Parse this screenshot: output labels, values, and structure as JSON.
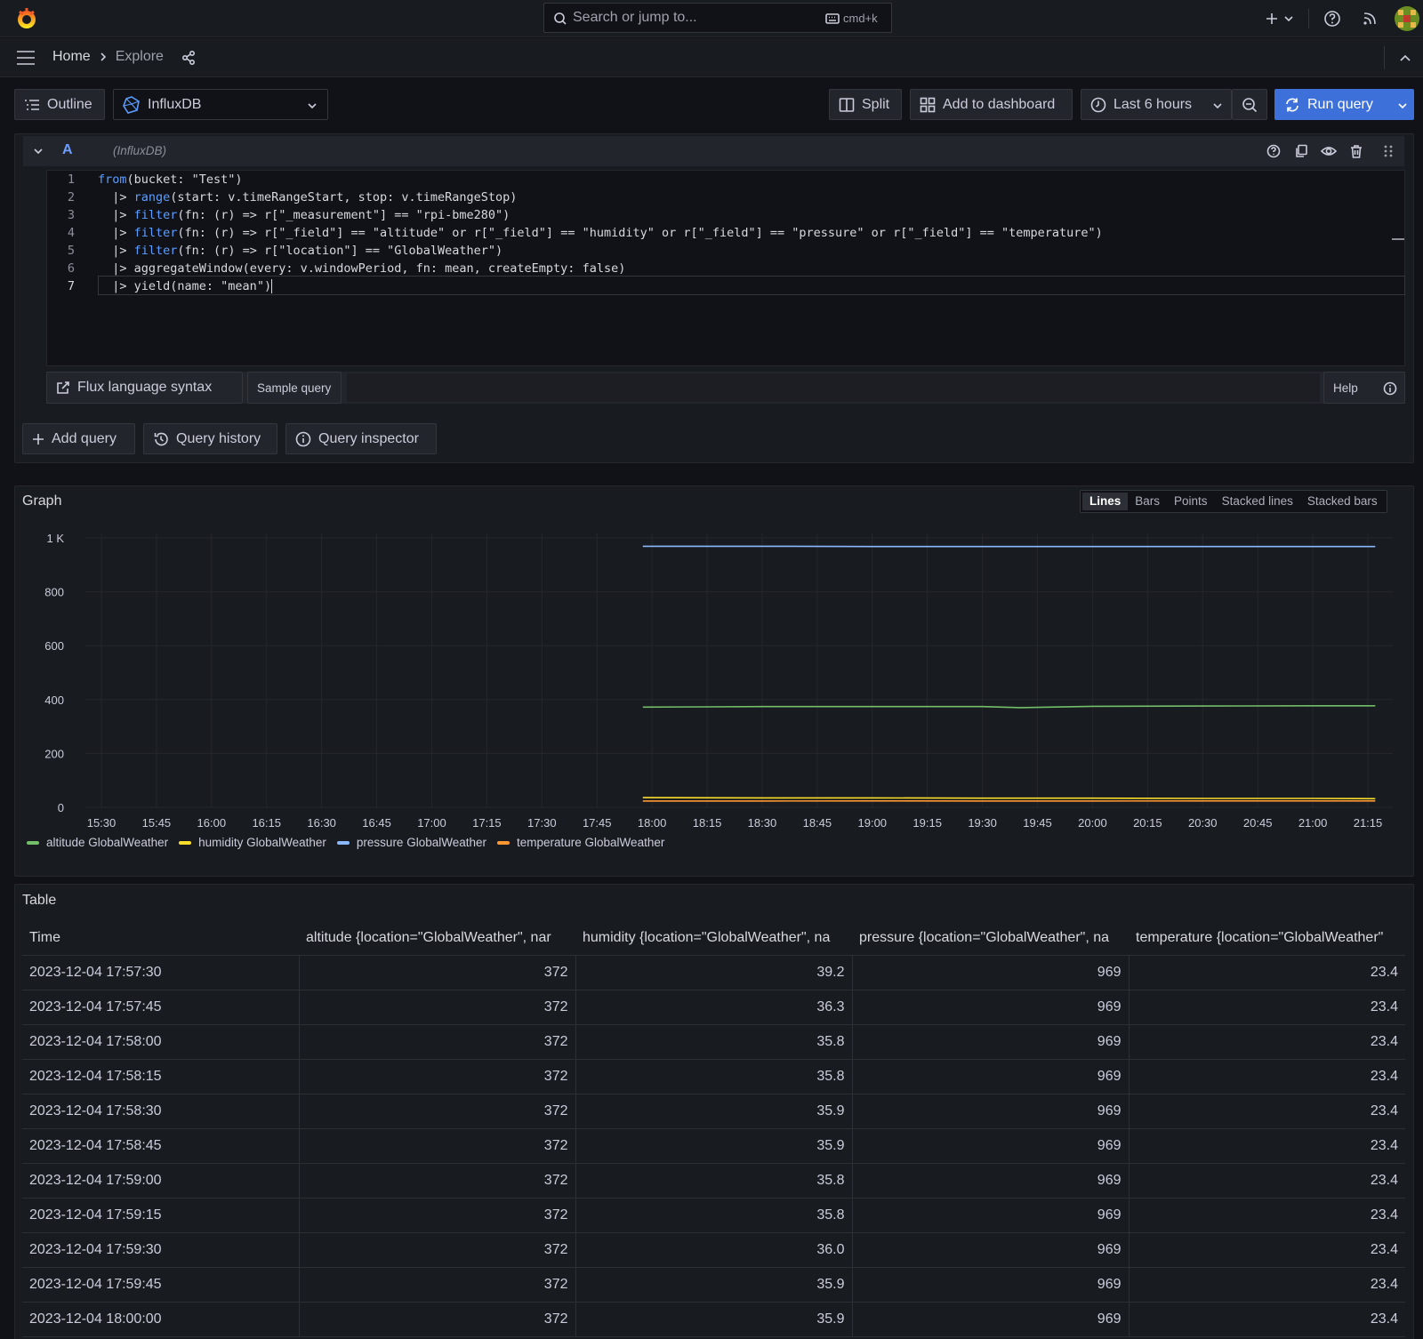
{
  "topbar": {
    "search_placeholder": "Search or jump to...",
    "shortcut": "cmd+k"
  },
  "breadcrumb": {
    "home": "Home",
    "current": "Explore"
  },
  "toolbar": {
    "outline": "Outline",
    "datasource": "InfluxDB",
    "split": "Split",
    "add_to_dashboard": "Add to dashboard",
    "time_range": "Last 6 hours",
    "run_query": "Run query"
  },
  "query": {
    "ref_id": "A",
    "datasource_label": "(InfluxDB)",
    "lines": [
      {
        "num": "1",
        "indent": "",
        "fn": "from",
        "rest": "(bucket: \"Test\")"
      },
      {
        "num": "2",
        "indent": "  |> ",
        "fn": "range",
        "rest": "(start: v.timeRangeStart, stop: v.timeRangeStop)"
      },
      {
        "num": "3",
        "indent": "  |> ",
        "fn": "filter",
        "rest": "(fn: (r) => r[\"_measurement\"] == \"rpi-bme280\")"
      },
      {
        "num": "4",
        "indent": "  |> ",
        "fn": "filter",
        "rest": "(fn: (r) => r[\"_field\"] == \"altitude\" or r[\"_field\"] == \"humidity\" or r[\"_field\"] == \"pressure\" or r[\"_field\"] == \"temperature\")"
      },
      {
        "num": "5",
        "indent": "  |> ",
        "fn": "filter",
        "rest": "(fn: (r) => r[\"location\"] == \"GlobalWeather\")"
      },
      {
        "num": "6",
        "indent": "  |> ",
        "fn": "aggregateWindow",
        "rest": "(every: v.windowPeriod, fn: mean, createEmpty: false)"
      },
      {
        "num": "7",
        "indent": "  |> ",
        "fn": "yield",
        "rest": "(name: \"mean\")"
      }
    ],
    "flux_syntax": "Flux language syntax",
    "sample_query": "Sample query",
    "help": "Help"
  },
  "actions": {
    "add_query": "Add query",
    "query_history": "Query history",
    "query_inspector": "Query inspector"
  },
  "graph": {
    "title": "Graph",
    "modes": [
      "Lines",
      "Bars",
      "Points",
      "Stacked lines",
      "Stacked bars"
    ],
    "active_mode": "Lines"
  },
  "chart_data": {
    "type": "line",
    "title": "Graph",
    "xlabel": "",
    "ylabel": "",
    "ylim": [
      0,
      1000
    ],
    "y_ticks": [
      "0",
      "200",
      "400",
      "600",
      "800",
      "1 K"
    ],
    "x_ticks": [
      "15:30",
      "15:45",
      "16:00",
      "16:15",
      "16:30",
      "16:45",
      "17:00",
      "17:15",
      "17:30",
      "17:45",
      "18:00",
      "18:15",
      "18:30",
      "18:45",
      "19:00",
      "19:15",
      "19:30",
      "19:45",
      "20:00",
      "20:15",
      "20:30",
      "20:45",
      "21:00",
      "21:15"
    ],
    "grid": true,
    "legend": "bottom-left",
    "series": [
      {
        "name": "altitude GlobalWeather",
        "color": "#73bf69",
        "x": [
          "17:57:30",
          "18:15",
          "18:30",
          "19:00",
          "19:30",
          "19:40",
          "20:00",
          "20:30",
          "21:00",
          "21:17"
        ],
        "values": [
          372,
          373,
          374,
          374,
          374,
          370,
          375,
          376,
          377,
          377
        ]
      },
      {
        "name": "humidity GlobalWeather",
        "color": "#fade2a",
        "x": [
          "17:57:30",
          "18:30",
          "19:00",
          "19:30",
          "20:00",
          "20:30",
          "21:00",
          "21:17"
        ],
        "values": [
          36,
          35,
          35,
          34,
          34,
          33,
          33,
          32
        ]
      },
      {
        "name": "pressure GlobalWeather",
        "color": "#8ab8ff",
        "x": [
          "17:57:30",
          "18:30",
          "19:00",
          "19:30",
          "20:00",
          "20:30",
          "21:00",
          "21:17"
        ],
        "values": [
          969,
          969,
          968,
          968,
          968,
          968,
          968,
          968
        ]
      },
      {
        "name": "temperature GlobalWeather",
        "color": "#ff9830",
        "x": [
          "17:57:30",
          "18:30",
          "19:00",
          "19:30",
          "20:00",
          "20:30",
          "21:00",
          "21:17"
        ],
        "values": [
          23.4,
          23.5,
          23.6,
          23.5,
          23.4,
          23.6,
          23.7,
          23.8
        ]
      }
    ]
  },
  "table": {
    "title": "Table",
    "columns": [
      "Time",
      "altitude {location=\"GlobalWeather\", nar",
      "humidity {location=\"GlobalWeather\", na",
      "pressure {location=\"GlobalWeather\", na",
      "temperature {location=\"GlobalWeather\""
    ],
    "rows": [
      [
        "2023-12-04 17:57:30",
        "372",
        "39.2",
        "969",
        "23.4"
      ],
      [
        "2023-12-04 17:57:45",
        "372",
        "36.3",
        "969",
        "23.4"
      ],
      [
        "2023-12-04 17:58:00",
        "372",
        "35.8",
        "969",
        "23.4"
      ],
      [
        "2023-12-04 17:58:15",
        "372",
        "35.8",
        "969",
        "23.4"
      ],
      [
        "2023-12-04 17:58:30",
        "372",
        "35.9",
        "969",
        "23.4"
      ],
      [
        "2023-12-04 17:58:45",
        "372",
        "35.9",
        "969",
        "23.4"
      ],
      [
        "2023-12-04 17:59:00",
        "372",
        "35.8",
        "969",
        "23.4"
      ],
      [
        "2023-12-04 17:59:15",
        "372",
        "35.8",
        "969",
        "23.4"
      ],
      [
        "2023-12-04 17:59:30",
        "372",
        "36.0",
        "969",
        "23.4"
      ],
      [
        "2023-12-04 17:59:45",
        "372",
        "35.9",
        "969",
        "23.4"
      ],
      [
        "2023-12-04 18:00:00",
        "372",
        "35.9",
        "969",
        "23.4"
      ]
    ]
  }
}
